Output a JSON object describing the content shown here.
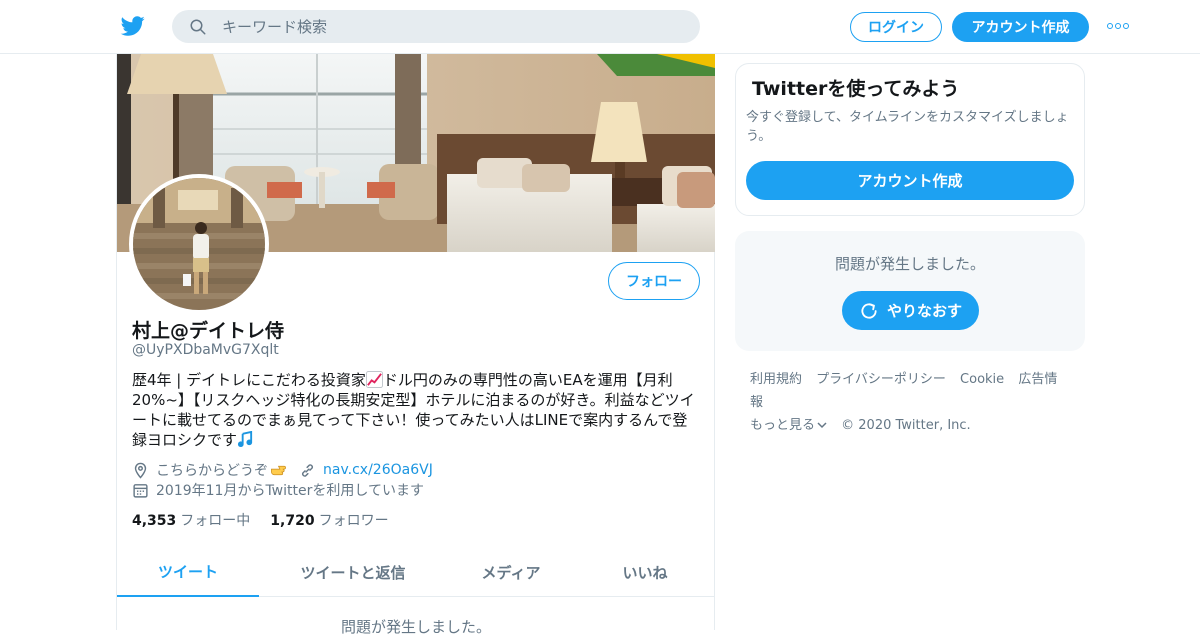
{
  "header": {
    "search_placeholder": "キーワード検索",
    "login_label": "ログイン",
    "signup_label": "アカウント作成"
  },
  "profile": {
    "name": "村上@デイトレ侍",
    "handle": "@UyPXDbaMvG7Xqlt",
    "bio_part1": "歴4年 | デイトレにこだわる投資家",
    "bio_part2": "ドル円のみの専門性の高いEAを運用【月利20%~】【リスクヘッジ特化の長期安定型】ホテルに泊まるのが好き。利益などツイートに載せてるのでまぁ見てって下さい！使ってみたい人はLINEで案内するんで登録ヨロシクです",
    "bio_emoji1": "chart-increasing-emoji",
    "bio_emoji2": "music-notes-emoji",
    "location": "こちらからどうぞ",
    "location_emoji": "pointing-right-emoji",
    "url": "nav.cx/26Oa6VJ",
    "joined": "2019年11月からTwitterを利用しています",
    "following_count": "4,353",
    "following_label": "フォロー中",
    "followers_count": "1,720",
    "followers_label": "フォロワー",
    "follow_button": "フォロー",
    "banner_image": "hotel-room-photo",
    "avatar_image": "person-on-stairs-photo"
  },
  "tabs": [
    {
      "label": "ツイート",
      "active": true
    },
    {
      "label": "ツイートと返信",
      "active": false
    },
    {
      "label": "メディア",
      "active": false
    },
    {
      "label": "いいね",
      "active": false
    }
  ],
  "timeline": {
    "error_message": "問題が発生しました。"
  },
  "signup_card": {
    "title": "Twitterを使ってみよう",
    "description": "今すぐ登録して、タイムラインをカスタマイズしましょう。",
    "button": "アカウント作成"
  },
  "error_card": {
    "message": "問題が発生しました。",
    "retry_button": "やりなおす"
  },
  "footer": {
    "links": [
      "利用規約",
      "プライバシーポリシー",
      "Cookie",
      "広告情報"
    ],
    "more": "もっと見る",
    "copyright": "© 2020 Twitter, Inc."
  },
  "colors": {
    "accent": "#1da1f2",
    "text_secondary": "#657786",
    "border": "#e6ecf0"
  }
}
